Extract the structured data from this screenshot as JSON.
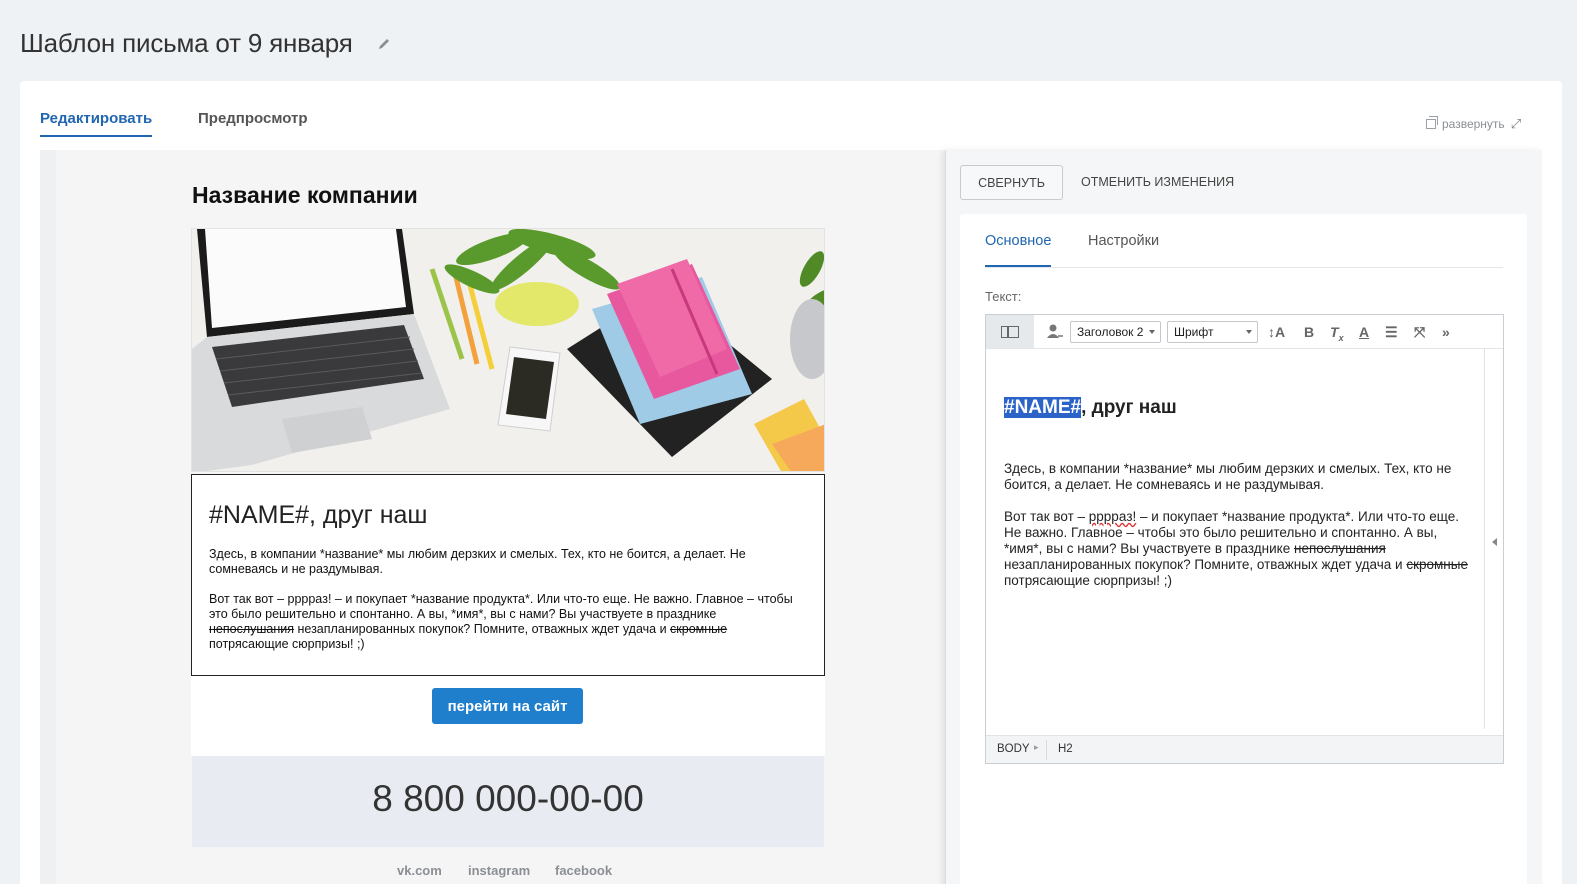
{
  "page": {
    "title": "Шаблон письма от 9 января"
  },
  "tabs": {
    "edit": "Редактировать",
    "preview": "Предпросмотр"
  },
  "expand": {
    "label": "развернуть"
  },
  "email": {
    "company": "Название компании",
    "heading": "#NAME#, друг наш",
    "p1": "Здесь, в компании *название* мы любим дерзких и смелых. Тех, кто не боится, а делает. Не сомневаясь и не раздумывая.",
    "p2_a": "Вот так вот – ррррaз! – и покупает *название продукта*. Или что-то еще. Не важно. Главное – чтобы это было решительно и спонтанно. А вы, *имя*, вы с нами? Вы участвуете в празднике ",
    "p2_strike1": "непослушания",
    "p2_b": " незапланированных покупок? Помните, отважных ждет удача и ",
    "p2_strike2": "скромные",
    "p2_c": " потрясающие сюрпризы! ;)",
    "cta": "перейти на сайт",
    "phone": "8 800 000-00-00",
    "social": [
      "vk.com",
      "instagram",
      "facebook"
    ]
  },
  "panel": {
    "collapse": "СВЕРНУТЬ",
    "revert": "ОТМЕНИТЬ ИЗМЕНЕНИЯ",
    "tabs": {
      "main": "Основное",
      "settings": "Настройки"
    },
    "text_label": "Текст:",
    "toolbar": {
      "format": "Заголовок 2",
      "font": "Шрифт"
    },
    "editor": {
      "h2_highlight": "#NAME#",
      "h2_rest": ", друг наш",
      "p1": "Здесь, в компании *название* мы любим дерзких и смелых. Тех, кто не боится, а делает. Не сомневаясь и не раздумывая.",
      "p2_a": "Вот так вот – ",
      "p2_squig": "ррррaз!",
      "p2_b": " – и покупает *название продукта*. Или что-то еще. Не важно. Главное – чтобы это было решительно и спонтанно. А вы, *имя*, вы с нами? Вы участвуете в празднике ",
      "p2_strike1": "непослушания",
      "p2_c": " незапланированных покупок? Помните, отважных ждет удача и ",
      "p2_strike2": "скромные",
      "p2_d": " потрясающие сюрпризы! ;)"
    },
    "status": {
      "body": "BODY",
      "h2": "H2"
    }
  }
}
